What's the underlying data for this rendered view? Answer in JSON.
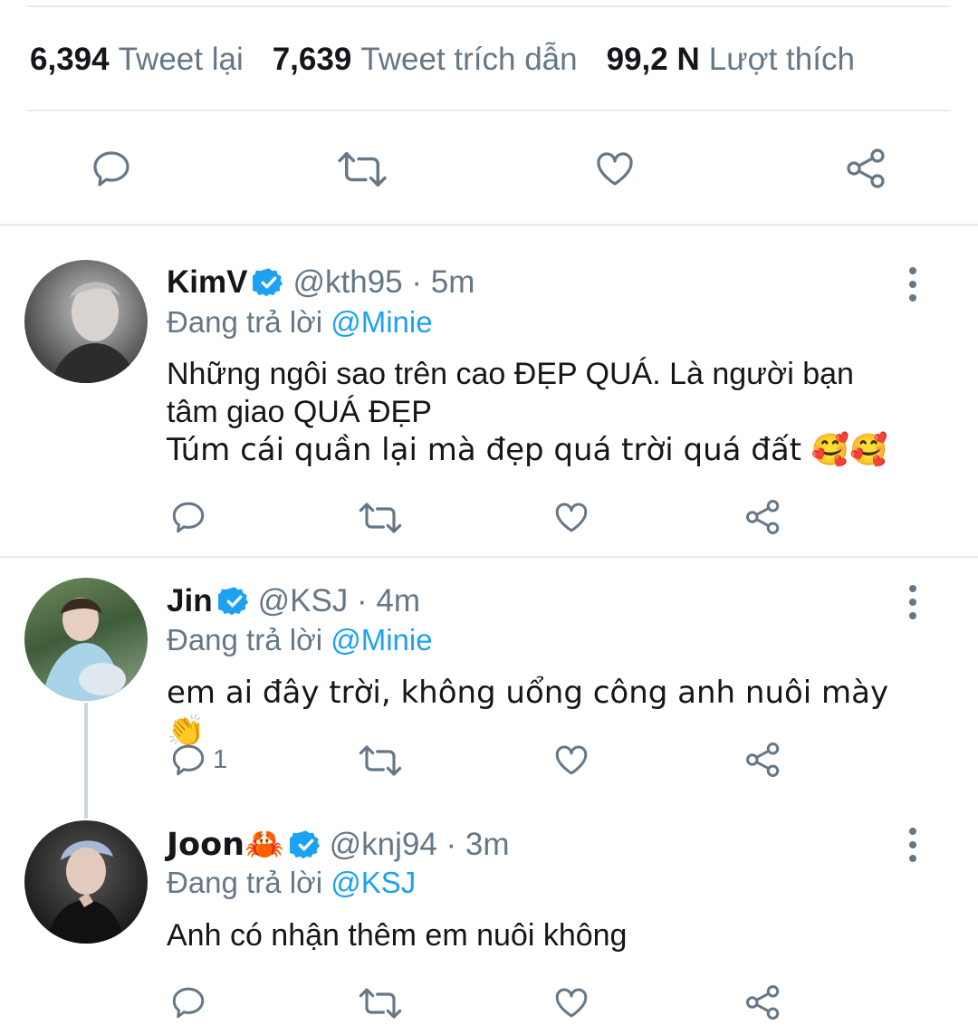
{
  "stats": [
    {
      "count": "6,394",
      "label": "Tweet lại"
    },
    {
      "count": "7,639",
      "label": "Tweet trích dẫn"
    },
    {
      "count": "99,2 N",
      "label": "Lượt thích"
    }
  ],
  "action_icons": [
    "reply-icon",
    "retweet-icon",
    "like-icon",
    "share-icon"
  ],
  "tweets": [
    {
      "name": "KimV",
      "handle": "@kth95 · 5m",
      "reply_prefix": "Đang trả lời",
      "reply_to": "@Minie",
      "text_lines": [
        "Những ngôi sao trên cao ĐẸP QUÁ. Là người bạn",
        "tâm giao QUÁ ĐẸP",
        "Túm cái quần lại mà đẹp quá trời quá đất 🥰🥰"
      ],
      "reply_count": ""
    },
    {
      "name": "Jin",
      "handle": "@KSJ · 4m",
      "reply_prefix": "Đang trả lời",
      "reply_to": "@Minie",
      "text_lines": [
        "em ai đây trời, không uổng công anh nuôi mày 👏"
      ],
      "reply_count": "1"
    },
    {
      "name": "Joon🦀",
      "handle": "@knj94 · 3m",
      "reply_prefix": "Đang trả lời",
      "reply_to": "@KSJ",
      "text_lines": [
        "Anh có nhận thêm em nuôi không"
      ],
      "reply_count": ""
    }
  ],
  "colors": {
    "accent": "#1da1f2",
    "muted": "#657786",
    "divider": "#e6ecf0"
  }
}
